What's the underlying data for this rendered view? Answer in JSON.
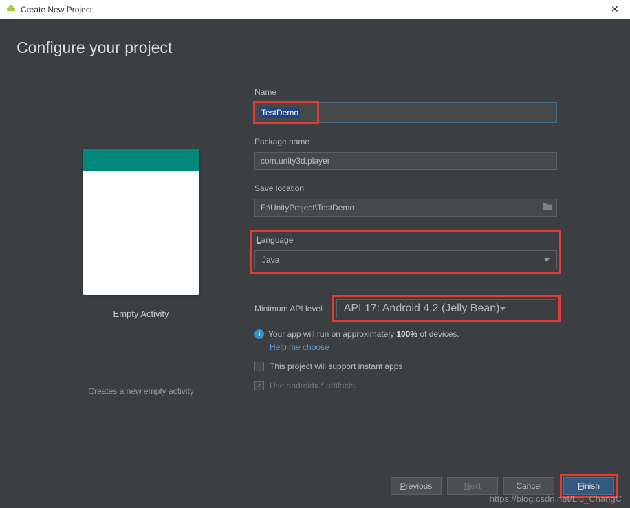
{
  "titlebar": {
    "title": "Create New Project"
  },
  "header": {
    "page_title": "Configure your project"
  },
  "preview": {
    "label": "Empty Activity",
    "description": "Creates a new empty activity"
  },
  "form": {
    "name_label_pre": "N",
    "name_label_rest": "ame",
    "name_value": "TestDemo",
    "package_label": "Package name",
    "package_value": "com.unity3d.player",
    "save_label_pre": "S",
    "save_label_rest": "ave location",
    "save_value": "F:\\UnityProject\\TestDemo",
    "language_label_pre": "L",
    "language_label_rest": "anguage",
    "language_value": "Java",
    "api_label": "Minimum API level",
    "api_value": "API 17: Android 4.2 (Jelly Bean)",
    "info_text_pre": "Your app will run on approximately ",
    "info_percent": "100%",
    "info_text_post": " of devices.",
    "help_link": "Help me choose",
    "instant_apps_label": "This project will support instant apps",
    "androidx_label": "Use androidx.* artifacts"
  },
  "buttons": {
    "previous_pre": "P",
    "previous_rest": "revious",
    "next_pre": "N",
    "next_rest": "ext",
    "cancel": "Cancel",
    "finish_pre": "F",
    "finish_rest": "inish"
  },
  "watermark": "https://blog.csdn.net/Liu_ChangC"
}
